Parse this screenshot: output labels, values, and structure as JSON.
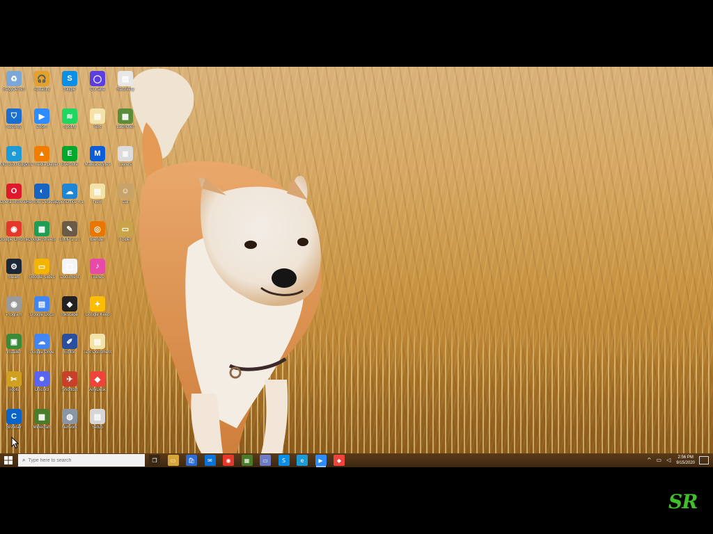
{
  "desktop": {
    "icons": [
      {
        "label": "Recycle Bin",
        "icon": "recycle-bin-icon",
        "color": "#7aa6d8",
        "glyph": "♻"
      },
      {
        "label": "Audacity",
        "icon": "audacity-icon",
        "color": "#e2a12b",
        "glyph": "🎧"
      },
      {
        "label": "Skype",
        "icon": "skype-icon",
        "color": "#0a8ee6",
        "glyph": "S"
      },
      {
        "label": "Cortana",
        "icon": "circle-app-icon",
        "color": "#5b3ee0",
        "glyph": "◯"
      },
      {
        "label": "Recovery",
        "icon": "document-icon",
        "color": "#e7e7e7",
        "glyph": "▤"
      },
      {
        "label": "Security",
        "icon": "shield-icon",
        "color": "#1a6fd0",
        "glyph": "⛉"
      },
      {
        "label": "Zoom",
        "icon": "zoom-icon",
        "color": "#2d8cff",
        "glyph": "▶"
      },
      {
        "label": "Spotify",
        "icon": "spotify-icon",
        "color": "#1ed760",
        "glyph": "≋"
      },
      {
        "label": "Text",
        "icon": "text-file-icon",
        "color": "#f3e3a8",
        "glyph": "▤"
      },
      {
        "label": "Launcher",
        "icon": "minecraft-icon",
        "color": "#5a8d3a",
        "glyph": "▦"
      },
      {
        "label": "Microsoft Edge",
        "icon": "edge-icon",
        "color": "#1e9ad6",
        "glyph": "e"
      },
      {
        "label": "VLC media player",
        "icon": "vlc-icon",
        "color": "#f07d00",
        "glyph": "▲"
      },
      {
        "label": "Evernote",
        "icon": "evernote-icon",
        "color": "#00a82d",
        "glyph": "E"
      },
      {
        "label": "Malwarebytes",
        "icon": "malwarebytes-icon",
        "color": "#0b5ed7",
        "glyph": "M"
      },
      {
        "label": "Layers",
        "icon": "layers-icon",
        "color": "#dcdcdc",
        "glyph": "≣"
      },
      {
        "label": "Opera Browser",
        "icon": "opera-icon",
        "color": "#e0182c",
        "glyph": "O"
      },
      {
        "label": "Remote Desktop",
        "icon": "remote-desktop-icon",
        "color": "#1763c2",
        "glyph": "◐"
      },
      {
        "label": "OpenOffice 4.1",
        "icon": "openoffice-icon",
        "color": "#1f86d6",
        "glyph": "☁"
      },
      {
        "label": "New",
        "icon": "text-file-icon",
        "color": "#f3e3a8",
        "glyph": "▤"
      },
      {
        "label": "Cat",
        "icon": "cat-icon",
        "color": "#c7a36a",
        "glyph": "☺"
      },
      {
        "label": "Google Chrome",
        "icon": "chrome-icon",
        "color": "#e5382b",
        "glyph": "◉"
      },
      {
        "label": "Google Sheets",
        "icon": "sheets-icon",
        "color": "#1f9d55",
        "glyph": "▦"
      },
      {
        "label": "GIMP 2.10",
        "icon": "gimp-icon",
        "color": "#6b5a45",
        "glyph": "✎"
      },
      {
        "label": "Blender",
        "icon": "blender-icon",
        "color": "#ea7600",
        "glyph": "◎"
      },
      {
        "label": "Folder",
        "icon": "folder-icon",
        "color": "#c8a34a",
        "glyph": "▭"
      },
      {
        "label": "Steam",
        "icon": "steam-icon",
        "color": "#1b2838",
        "glyph": "⚙"
      },
      {
        "label": "Google Slides",
        "icon": "slides-icon",
        "color": "#f4b400",
        "glyph": "▭"
      },
      {
        "label": "Document",
        "icon": "blank-document-icon",
        "color": "#f5f5f5",
        "glyph": "▢"
      },
      {
        "label": "iTunes",
        "icon": "itunes-icon",
        "color": "#e84aa8",
        "glyph": "♪"
      },
      {
        "label": "Program",
        "icon": "disc-icon",
        "color": "#9a9a9a",
        "glyph": "◉"
      },
      {
        "label": "Google Docs",
        "icon": "docs-icon",
        "color": "#4285f4",
        "glyph": "▤"
      },
      {
        "label": "Inkscape",
        "icon": "inkscape-icon",
        "color": "#222222",
        "glyph": "◆"
      },
      {
        "label": "Google Keep",
        "icon": "keep-icon",
        "color": "#fbbc04",
        "glyph": "✦"
      },
      {
        "label": "Installer",
        "icon": "installer-icon",
        "color": "#3a8a3a",
        "glyph": "▣"
      },
      {
        "label": "Google Drive",
        "icon": "cloud-icon",
        "color": "#4285f4",
        "glyph": "☁"
      },
      {
        "label": "Editor",
        "icon": "editor-icon",
        "color": "#2a4f9e",
        "glyph": "✐"
      },
      {
        "label": "Text Document",
        "icon": "text-file-icon",
        "color": "#f3e3a8",
        "glyph": "▤"
      },
      {
        "label": "Tools",
        "icon": "tools-icon",
        "color": "#d0a020",
        "glyph": "✂"
      },
      {
        "label": "Discord",
        "icon": "discord-icon",
        "color": "#5865f2",
        "glyph": "☻"
      },
      {
        "label": "Shortcut",
        "icon": "shortcut-icon",
        "color": "#c8402a",
        "glyph": "✈"
      },
      {
        "label": "AnyDesk",
        "icon": "anydesk-icon",
        "color": "#ef443b",
        "glyph": "◆"
      },
      {
        "label": "Browser",
        "icon": "browser-icon",
        "color": "#0a64c8",
        "glyph": "C"
      },
      {
        "label": "Minecraft",
        "icon": "grass-block-icon",
        "color": "#4a7d2a",
        "glyph": "▦"
      },
      {
        "label": "Network",
        "icon": "globe-icon",
        "color": "#8a96a6",
        "glyph": "◍"
      },
      {
        "label": "Setup",
        "icon": "setup-icon",
        "color": "#d6d6d6",
        "glyph": "▤"
      }
    ]
  },
  "taskbar": {
    "search_placeholder": "Type here to search",
    "apps": [
      {
        "name": "task-view",
        "icon": "task-view-icon",
        "color": "#3c2712",
        "glyph": "❐"
      },
      {
        "name": "file-explorer",
        "icon": "folder-icon",
        "color": "#d9a53a",
        "glyph": "▭"
      },
      {
        "name": "microsoft-store",
        "icon": "store-icon",
        "color": "#2c6ed6",
        "glyph": "🛍"
      },
      {
        "name": "mail",
        "icon": "mail-icon",
        "color": "#0a73d9",
        "glyph": "✉"
      },
      {
        "name": "chrome",
        "icon": "chrome-icon",
        "color": "#e5382b",
        "glyph": "◉"
      },
      {
        "name": "minecraft",
        "icon": "grass-block-icon",
        "color": "#4a7d2a",
        "glyph": "▦"
      },
      {
        "name": "messages",
        "icon": "chat-icon",
        "color": "#6a7cc6",
        "glyph": "▭"
      },
      {
        "name": "skype",
        "icon": "skype-icon",
        "color": "#0a8ee6",
        "glyph": "S"
      },
      {
        "name": "edge",
        "icon": "edge-icon",
        "color": "#1e9ad6",
        "glyph": "e"
      },
      {
        "name": "zoom",
        "icon": "zoom-icon",
        "color": "#2d8cff",
        "glyph": "▶"
      },
      {
        "name": "anydesk",
        "icon": "anydesk-icon",
        "color": "#ef443b",
        "glyph": "◆"
      }
    ],
    "clock_time": "2:56 PM",
    "clock_date": "9/15/2020"
  },
  "watermark": "SR"
}
